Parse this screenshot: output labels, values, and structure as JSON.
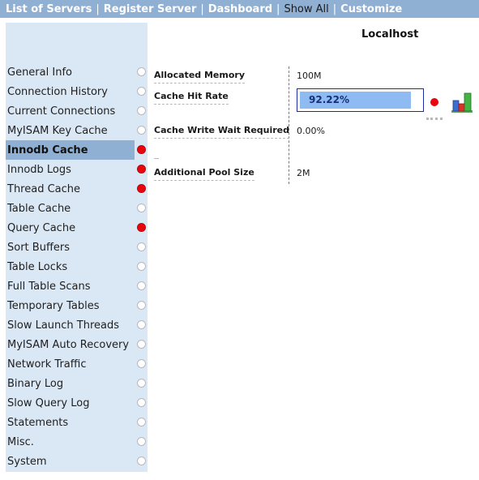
{
  "topnav": {
    "items": [
      {
        "label": "List of Servers",
        "style": "bold"
      },
      {
        "label": "Register Server",
        "style": "bold"
      },
      {
        "label": "Dashboard",
        "style": "bold"
      },
      {
        "label": "Show All",
        "style": "plain"
      },
      {
        "label": "Customize",
        "style": "bold"
      }
    ],
    "separator": "|"
  },
  "sidebar": {
    "active_index": 4,
    "items": [
      {
        "label": "General Info",
        "status": "none"
      },
      {
        "label": "Connection History",
        "status": "none"
      },
      {
        "label": "Current Connections",
        "status": "none"
      },
      {
        "label": "MyISAM Key Cache",
        "status": "none"
      },
      {
        "label": "Innodb Cache",
        "status": "alert"
      },
      {
        "label": "Innodb Logs",
        "status": "alert"
      },
      {
        "label": "Thread Cache",
        "status": "alert"
      },
      {
        "label": "Table Cache",
        "status": "none"
      },
      {
        "label": "Query Cache",
        "status": "alert"
      },
      {
        "label": "Sort Buffers",
        "status": "none"
      },
      {
        "label": "Table Locks",
        "status": "none"
      },
      {
        "label": "Full Table Scans",
        "status": "none"
      },
      {
        "label": "Temporary Tables",
        "status": "none"
      },
      {
        "label": "Slow Launch Threads",
        "status": "none"
      },
      {
        "label": "MyISAM Auto Recovery",
        "status": "none"
      },
      {
        "label": "Network Traffic",
        "status": "none"
      },
      {
        "label": "Binary Log",
        "status": "none"
      },
      {
        "label": "Slow Query Log",
        "status": "none"
      },
      {
        "label": "Statements",
        "status": "none"
      },
      {
        "label": "Misc.",
        "status": "none"
      },
      {
        "label": "System",
        "status": "none"
      }
    ]
  },
  "main": {
    "host": "Localhost",
    "metrics": {
      "allocated_memory": {
        "label": "Allocated Memory",
        "value": "100M"
      },
      "cache_hit_rate": {
        "label": "Cache Hit Rate",
        "value": "92.22%",
        "fill_fraction": 0.9222,
        "status": "alert"
      },
      "cache_write_wait": {
        "label": "Cache Write Wait Required",
        "value": "0.00%"
      },
      "additional_pool_size": {
        "label": "Additional Pool Size",
        "value": "2M"
      }
    }
  },
  "colors": {
    "nav_bg": "#8fafd3",
    "sidebar_bg": "#dae7f5",
    "alert": "#e8050c",
    "bar_fill": "#8ebcf2",
    "bar_border": "#1c2ba5"
  },
  "icons": {
    "chart": "bar-chart-icon"
  }
}
